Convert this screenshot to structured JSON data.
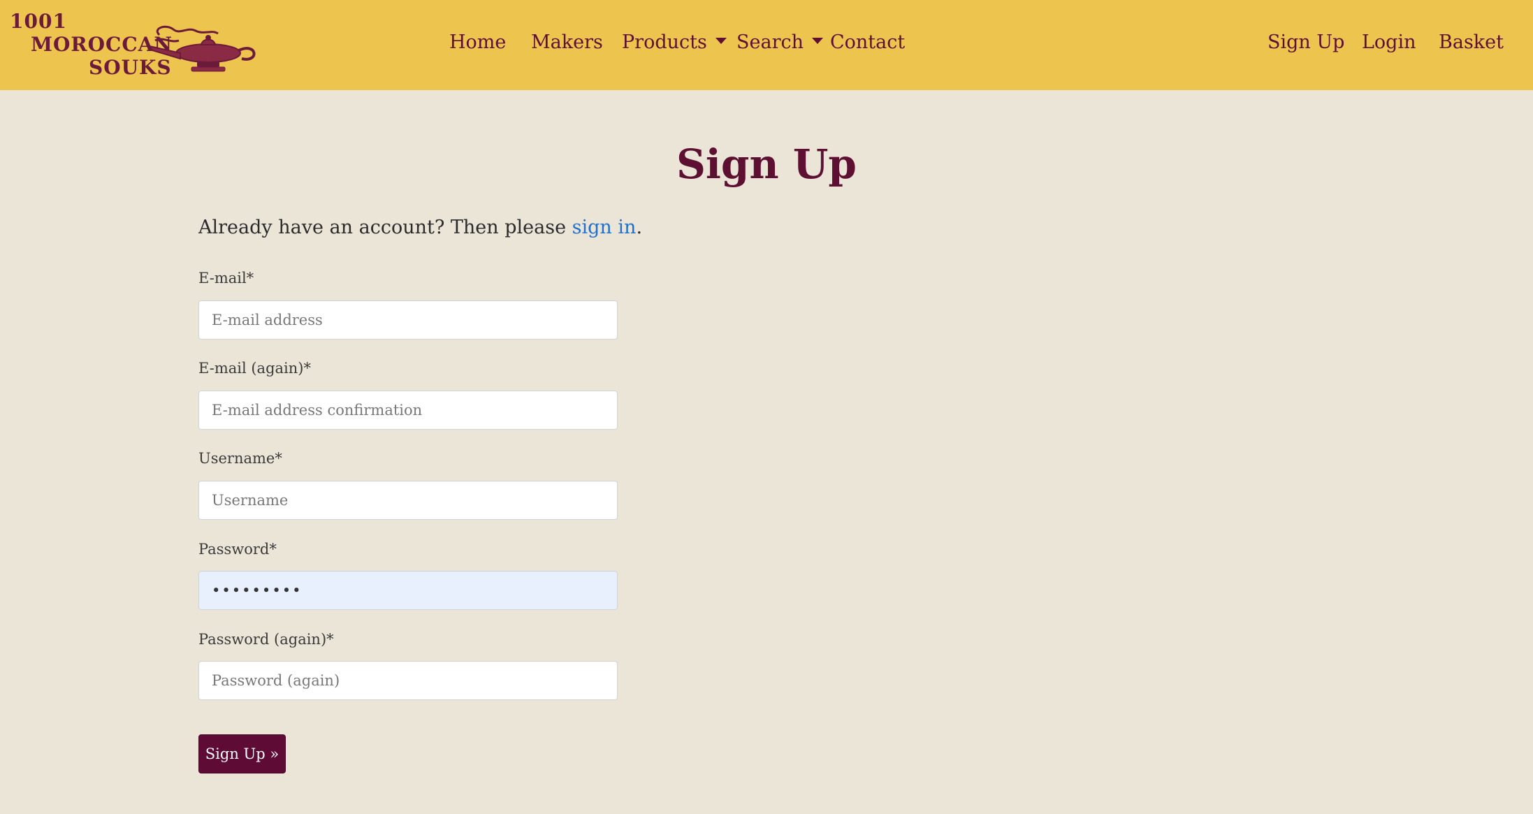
{
  "brand": {
    "line1": "1001",
    "line2": "MOROCCAN",
    "line3": "SOUKS",
    "icon": "magic-lamp-icon"
  },
  "nav": {
    "home": "Home",
    "makers": "Makers",
    "products": "Products",
    "search": "Search",
    "contact": "Contact",
    "signup": "Sign Up",
    "login": "Login",
    "basket": "Basket"
  },
  "page": {
    "title": "Sign Up",
    "intro_prefix": "Already have an account? Then please ",
    "intro_link": "sign in",
    "intro_suffix": "."
  },
  "form": {
    "email_label": "E-mail*",
    "email_placeholder": "E-mail address",
    "email2_label": "E-mail (again)*",
    "email2_placeholder": "E-mail address confirmation",
    "username_label": "Username*",
    "username_placeholder": "Username",
    "password_label": "Password*",
    "password_value": "•••••••••",
    "password2_label": "Password (again)*",
    "password2_placeholder": "Password (again)",
    "submit_label": "Sign Up »"
  },
  "colors": {
    "navbar": "#ecc44e",
    "background": "#ebe5d8",
    "brand": "#5e1033",
    "link": "#1f6fd1",
    "button": "#5e0b36"
  }
}
